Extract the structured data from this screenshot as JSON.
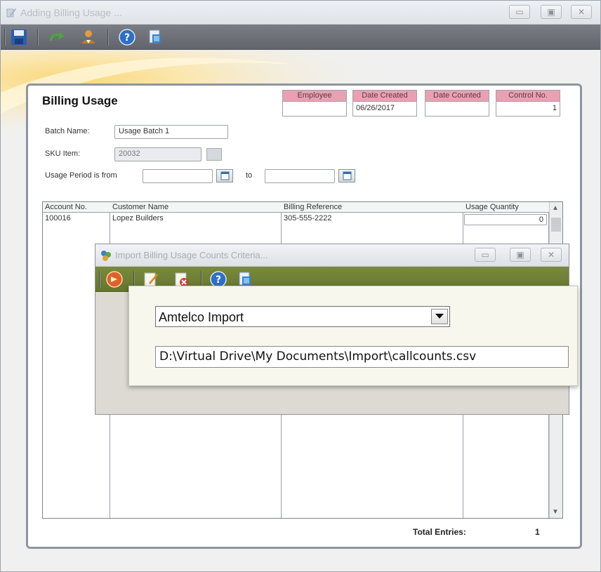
{
  "window": {
    "title": "Adding Billing Usage ..."
  },
  "panel": {
    "title": "Billing Usage",
    "header_fields": [
      {
        "label": "Employee",
        "value": ""
      },
      {
        "label": "Date Created",
        "value": "06/26/2017"
      },
      {
        "label": "Date Counted",
        "value": ""
      },
      {
        "label": "Control No.",
        "value": "1"
      }
    ],
    "batch_name_label": "Batch Name:",
    "batch_name_value": "Usage Batch 1",
    "sku_label": "SKU Item:",
    "sku_value": "20032",
    "period_label": "Usage Period is from",
    "period_from": "",
    "period_to_label": "to",
    "period_to": ""
  },
  "grid": {
    "columns": [
      "Account No.",
      "Customer Name",
      "Billing Reference",
      "Usage Quantity"
    ],
    "rows": [
      {
        "account": "100016",
        "customer": "Lopez Builders",
        "reference": "305-555-2222",
        "quantity": "0"
      }
    ]
  },
  "totals": {
    "label": "Total Entries:",
    "value": "1"
  },
  "dialog": {
    "title": "Import Billing Usage Counts Criteria...",
    "import_type": "Amtelco Import",
    "file_path": "D:\\Virtual Drive\\My Documents\\Import\\callcounts.csv"
  },
  "colors": {
    "toolbar_main": "#6b6f75",
    "toolbar_dialog": "#6e7e33",
    "header_label_bg": "#e7a1b3",
    "panel_border": "#8e959d"
  },
  "icons": {
    "main_toolbar": [
      "save-icon",
      "refresh-arrow-icon",
      "user-import-icon",
      "help-icon",
      "print-preview-icon"
    ],
    "dialog_toolbar": [
      "run-import-icon",
      "edit-icon",
      "delete-icon",
      "help-icon",
      "print-preview-icon"
    ]
  }
}
